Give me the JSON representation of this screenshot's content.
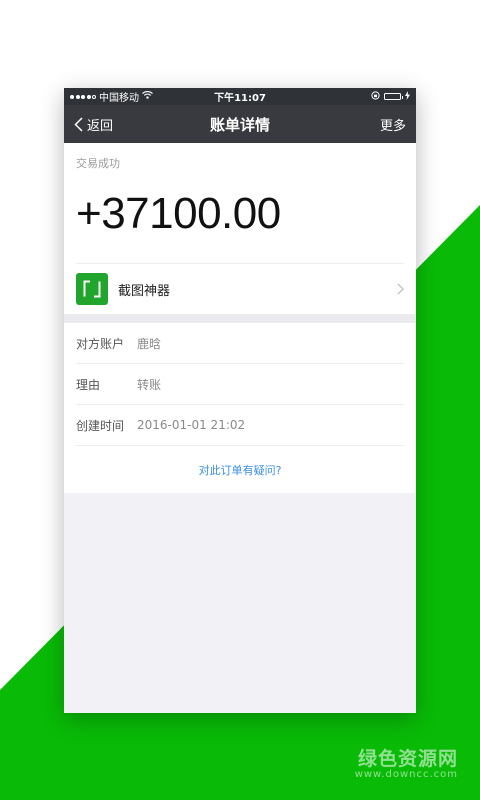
{
  "colors": {
    "brand_green": "#09bb07",
    "nav_bar": "#393a3f",
    "status_bar": "#2f3237",
    "link_blue": "#3a8ee6",
    "merchant_icon_bg": "#22a52d"
  },
  "status_bar": {
    "carrier": "中国移动",
    "time": "下午11:07",
    "battery_level": 1.0
  },
  "nav": {
    "back_label": "返回",
    "title": "账单详情",
    "more_label": "更多"
  },
  "transaction": {
    "status": "交易成功",
    "amount": "+37100.00"
  },
  "merchant": {
    "name": "截图神器",
    "icon": "screenshot-app-icon"
  },
  "details": [
    {
      "label": "对方账户",
      "value": "鹿晗"
    },
    {
      "label": "理由",
      "value": "转账"
    },
    {
      "label": "创建时间",
      "value": "2016-01-01 21:02"
    }
  ],
  "question_link": "对此订单有疑问?",
  "watermark": {
    "cn": "绿色资源网",
    "en": "www.downcc.com"
  }
}
